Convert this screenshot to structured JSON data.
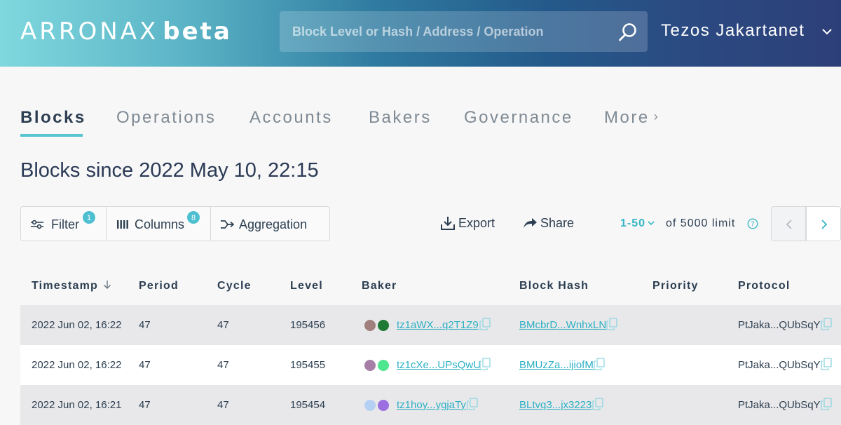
{
  "header": {
    "logo_main": "ARRONAX",
    "logo_beta": "beta",
    "search_placeholder": "Block Level or Hash / Address / Operation",
    "network": "Tezos Jakartanet"
  },
  "tabs": [
    {
      "label": "Blocks",
      "active": true
    },
    {
      "label": "Operations"
    },
    {
      "label": "Accounts"
    },
    {
      "label": "Bakers"
    },
    {
      "label": "Governance"
    },
    {
      "label": "More"
    }
  ],
  "page_title": "Blocks since 2022 May 10, 22:15",
  "toolbar": {
    "filter_label": "Filter",
    "filter_count": "1",
    "columns_label": "Columns",
    "columns_count": "8",
    "aggregation_label": "Aggregation",
    "export_label": "Export",
    "share_label": "Share",
    "range_label": "1-50",
    "limit_label": "of 5000 limit"
  },
  "table": {
    "headers": [
      "Timestamp",
      "Period",
      "Cycle",
      "Level",
      "Baker",
      "Block Hash",
      "Priority",
      "Protocol"
    ],
    "rows": [
      {
        "timestamp": "2022 Jun 02, 16:22",
        "period": "47",
        "cycle": "47",
        "level": "195456",
        "baker": "tz1aWX...q2T1Z9",
        "baker_colors": [
          "#a07f7f",
          "#1f7a35"
        ],
        "hash": "BMcbrD...WnhxLN",
        "priority": "",
        "protocol": "PtJaka...QUbSqY"
      },
      {
        "timestamp": "2022 Jun 02, 16:22",
        "period": "47",
        "cycle": "47",
        "level": "195455",
        "baker": "tz1cXe...UPsQwU",
        "baker_colors": [
          "#a57fa5",
          "#4ee68e"
        ],
        "hash": "BMUzZa...ijiofM",
        "priority": "",
        "protocol": "PtJaka...QUbSqY"
      },
      {
        "timestamp": "2022 Jun 02, 16:21",
        "period": "47",
        "cycle": "47",
        "level": "195454",
        "baker": "tz1hoy...ygjaTy",
        "baker_colors": [
          "#b5d0f2",
          "#9b6fe0"
        ],
        "hash": "BLtvq3...jx3223",
        "priority": "",
        "protocol": "PtJaka...QUbSqY"
      }
    ]
  },
  "colors": {
    "accent": "#56c5d0",
    "link": "#2bb0c4",
    "text": "#2c3e50"
  }
}
